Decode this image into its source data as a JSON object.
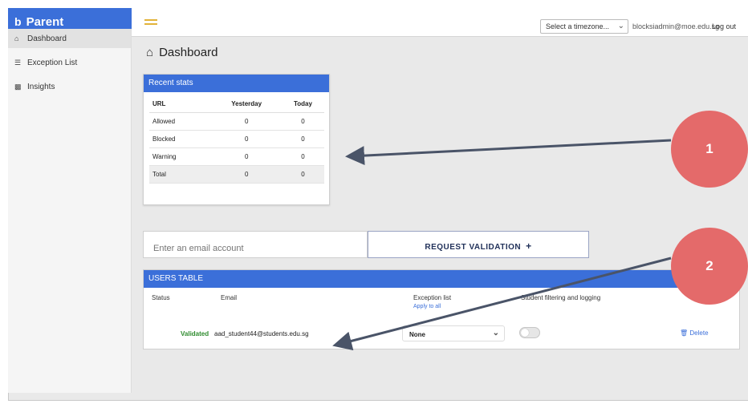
{
  "brand": {
    "mark": "b",
    "label": "Parent"
  },
  "topbar": {
    "timezone_placeholder": "Select a timezone...",
    "user_email": "blocksiadmin@moe.edu.sg",
    "logout_label": "Log out"
  },
  "sidebar": {
    "items": [
      {
        "label": "Dashboard",
        "icon": "home-icon",
        "active": true
      },
      {
        "label": "Exception List",
        "icon": "list-icon",
        "active": false
      },
      {
        "label": "Insights",
        "icon": "bar-chart-icon",
        "active": false
      }
    ]
  },
  "page": {
    "title": "Dashboard"
  },
  "recent_stats": {
    "title": "Recent stats",
    "headers": [
      "URL",
      "Yesterday",
      "Today"
    ],
    "rows": [
      [
        "Allowed",
        "0",
        "0"
      ],
      [
        "Blocked",
        "0",
        "0"
      ],
      [
        "Warning",
        "0",
        "0"
      ],
      [
        "Total",
        "0",
        "0"
      ]
    ]
  },
  "validation": {
    "email_placeholder": "Enter an email account",
    "request_label": "REQUEST VALIDATION",
    "request_icon": "+"
  },
  "users_table": {
    "title": "USERS TABLE",
    "headers": {
      "status": "Status",
      "email": "Email",
      "exception": "Exception list",
      "filtering": "Student filtering and logging"
    },
    "apply_all": "Apply to all",
    "rows": [
      {
        "status": "Validated",
        "email": "aad_student44@students.edu.sg",
        "exception": "None",
        "filtering": false,
        "delete_label": "Delete"
      }
    ]
  },
  "annotations": {
    "badges": [
      "1",
      "2"
    ],
    "color": "#e46a6a"
  },
  "colors": {
    "accent": "#3b6fd9",
    "validated": "#2e8b2e",
    "hamburger": "#e2b33a"
  }
}
